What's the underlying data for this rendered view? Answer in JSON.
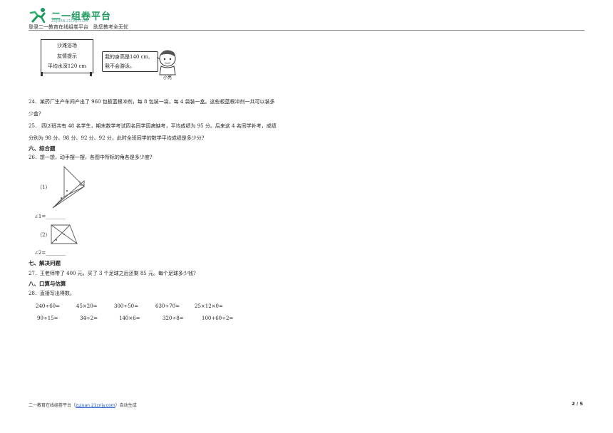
{
  "header": {
    "logo_text": "二一组卷平台",
    "logo_sub": "ZUJUAN.21CNJY.COM",
    "tagline": "登录二一教育在线组卷平台　助您教考全无忧"
  },
  "figure_pool": {
    "sign_lines": [
      "沙滩浴场",
      "友情提示",
      "平均水深120 cm"
    ],
    "bubble_lines": [
      "我的身高是140 cm,",
      "我不会游泳。"
    ],
    "boy_name": "小亮"
  },
  "questions": {
    "q24_line1": "24．某药厂生产车间产出了 960 包板蓝根冲剂，每 8 包装一袋，每 4 袋装一盒。这些板蓝根冲剂一共可以装多",
    "q24_line2": "少盒?",
    "q25_line1": "25．  四⑵班共有 48 名学生，期末数学考试四名同学因病缺考，平均成绩为 95 分。后来这 4 名同学补考，成绩",
    "q25_line2": "分别为 98 分、98 分、92 分、92 分，此时全班同学的数学平均成绩是多少分?",
    "section6": "六、综合题",
    "q26": "26．想一想，动手摆一摆，各图中所标的角各是多少度?",
    "q26_part1_label": "（1）",
    "q26_angle1": "∠1=________",
    "q26_part2_label": "（2）",
    "q26_angle2": "∠2=________",
    "section7": "七、解决问题",
    "q27": "27．王老师带了 400 元，买了 3 个足球之后还剩 85 元。每个足球多少钱?",
    "section8": "八、口算与估算",
    "q28": "28．直接写出得数。",
    "calc_row1": [
      "240÷60=",
      "45×20=",
      "300÷50=",
      "630÷70=",
      "25×12×0="
    ],
    "calc_row2": [
      "90÷15=",
      "34÷2=",
      "140×6=",
      "320÷8=",
      "100+60÷2="
    ]
  },
  "footer": {
    "text_before": "二一教育在线组卷平台（",
    "link": "zujuan.21cnjy.com",
    "text_after": "）自动生成",
    "page": "2 / 5"
  }
}
